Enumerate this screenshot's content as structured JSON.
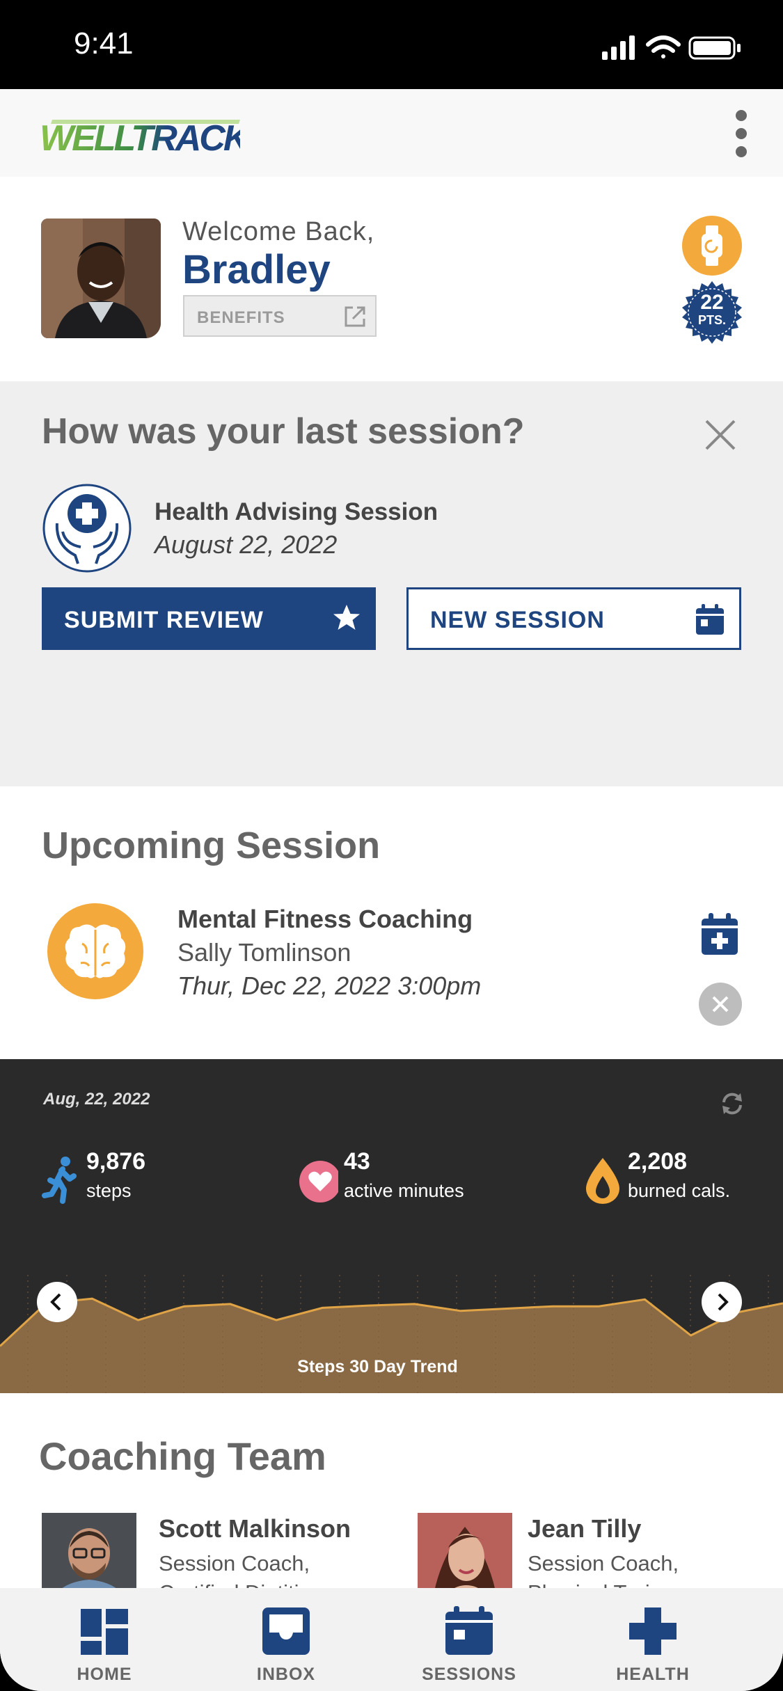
{
  "status_bar": {
    "time": "9:41"
  },
  "header": {
    "logo_text": "WELLTRACK",
    "menu_icon": "kebab-menu-icon"
  },
  "profile": {
    "greeting": "Welcome Back,",
    "name": "Bradley",
    "benefits_label": "BENEFITS",
    "points_value": "22",
    "points_label": "PTS."
  },
  "last_session": {
    "question": "How was your last session?",
    "session_name": "Health Advising Session",
    "session_date": "August 22, 2022",
    "submit_label": "SUBMIT REVIEW",
    "new_session_label": "NEW SESSION"
  },
  "upcoming": {
    "title": "Upcoming Session",
    "session_name": "Mental Fitness Coaching",
    "coach": "Sally Tomlinson",
    "datetime": "Thur, Dec 22, 2022 3:00pm"
  },
  "stats": {
    "date": "Aug, 22, 2022",
    "steps_value": "9,876",
    "steps_label": "steps",
    "active_value": "43",
    "active_label": "active minutes",
    "cals_value": "2,208",
    "cals_label": "burned cals.",
    "trend_caption": "Steps 30 Day Trend",
    "trend_fill": "#8a6a44",
    "trend_line": "#e0a446"
  },
  "chart_data": {
    "type": "area",
    "title": "Steps 30 Day Trend",
    "x": [
      1,
      2,
      3,
      4,
      5,
      6,
      7,
      8,
      9,
      10,
      11,
      12,
      13,
      14,
      15,
      16,
      17,
      18
    ],
    "values": [
      0.16,
      0.72,
      0.78,
      0.5,
      0.68,
      0.71,
      0.5,
      0.66,
      0.69,
      0.71,
      0.62,
      0.65,
      0.68,
      0.68,
      0.77,
      0.3,
      0.6,
      0.72
    ],
    "xlabel": "",
    "ylabel": "",
    "grid": false
  },
  "coaching": {
    "title": "Coaching Team",
    "coaches": [
      {
        "name": "Scott Malkinson",
        "role_line1": "Session Coach,",
        "role_line2": "Certified Dietitian"
      },
      {
        "name": "Jean Tilly",
        "role_line1": "Session Coach,",
        "role_line2": "Physical Trainer"
      }
    ]
  },
  "bottom_nav": {
    "items": [
      {
        "label": "HOME",
        "icon": "dashboard-icon"
      },
      {
        "label": "INBOX",
        "icon": "inbox-icon"
      },
      {
        "label": "SESSIONS",
        "icon": "calendar-icon"
      },
      {
        "label": "HEALTH",
        "icon": "health-cross-icon"
      }
    ]
  },
  "colors": {
    "brand_blue": "#1e4580",
    "accent_orange": "#f3a93b",
    "heart_pink": "#e9718c",
    "steps_blue": "#3a8fd6"
  }
}
